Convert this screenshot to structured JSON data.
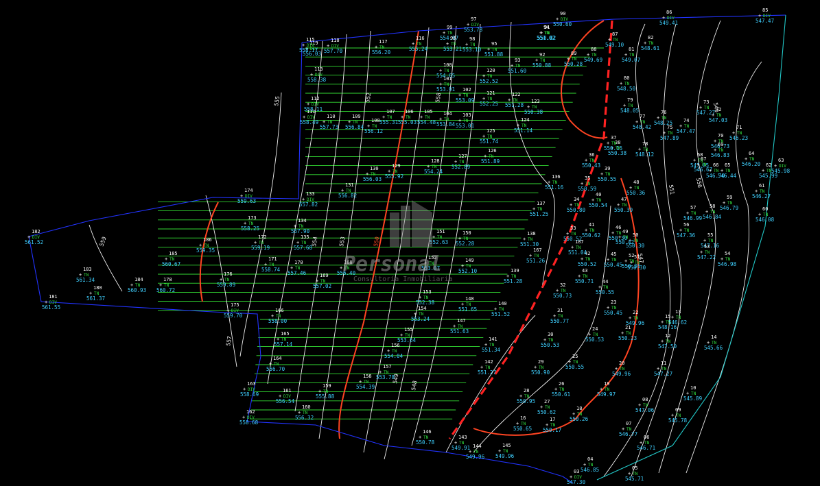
{
  "colors": {
    "background": "#000000",
    "boundary": "#2233ff",
    "boundary_right": "#22c8c8",
    "platform_lines": "#33dd33",
    "contour": "#f0f0f0",
    "contour_major": "#ff4422",
    "cut_line": "#ff2222",
    "point_number": "#ffffff",
    "elevation": "#3fd0ff",
    "code": "#30e040"
  },
  "watermark": {
    "brand": "Personal",
    "tagline": "Consultoría Inmobiliaria"
  },
  "contour_labels": [
    "559",
    "557",
    "555",
    "554",
    "553",
    "552",
    "550",
    "549",
    "548",
    "547",
    "551",
    "556",
    "558",
    "546"
  ],
  "points": [
    {
      "num": "182",
      "code": "DIV",
      "elev": "561.52"
    },
    {
      "num": "183",
      "code": "TN",
      "elev": "561.34"
    },
    {
      "num": "181",
      "code": "DIV",
      "elev": "561.55"
    },
    {
      "num": "180",
      "code": "TN",
      "elev": "561.37"
    },
    {
      "num": "184",
      "code": "TN",
      "elev": "560.93"
    },
    {
      "num": "174",
      "code": "DIV",
      "elev": "559.63"
    },
    {
      "num": "178",
      "code": "TN",
      "elev": "560.72"
    },
    {
      "num": "185",
      "code": "TN",
      "elev": "560.67"
    },
    {
      "num": "186",
      "code": "TN",
      "elev": "559.35"
    },
    {
      "num": "175",
      "code": "DIV",
      "elev": "559.70"
    },
    {
      "num": "176",
      "code": "TN",
      "elev": "559.89"
    },
    {
      "num": "173",
      "code": "TN",
      "elev": "558.25"
    },
    {
      "num": "172",
      "code": "TN",
      "elev": "559.19"
    },
    {
      "num": "171",
      "code": "TN",
      "elev": "558.74"
    },
    {
      "num": "133",
      "code": "DIV",
      "elev": "557.82"
    },
    {
      "num": "134",
      "code": "TN",
      "elev": "557.90"
    },
    {
      "num": "135",
      "code": "TN",
      "elev": "557.68"
    },
    {
      "num": "170",
      "code": "TN",
      "elev": "557.46"
    },
    {
      "num": "169",
      "code": "TN",
      "elev": "557.02"
    },
    {
      "num": "168",
      "code": "TN",
      "elev": "556.40"
    },
    {
      "num": "131",
      "code": "TN",
      "elev": "556.82"
    },
    {
      "num": "130",
      "code": "TN",
      "elev": "556.03"
    },
    {
      "num": "129",
      "code": "TN",
      "elev": "555.92"
    },
    {
      "num": "128",
      "code": "TN",
      "elev": "554.24"
    },
    {
      "num": "127",
      "code": "TN",
      "elev": "552.89"
    },
    {
      "num": "126",
      "code": "TN",
      "elev": "551.89"
    },
    {
      "num": "125",
      "code": "TN",
      "elev": "551.74"
    },
    {
      "num": "124",
      "code": "TN",
      "elev": "551.14"
    },
    {
      "num": "123",
      "code": "TN",
      "elev": "550.38"
    },
    {
      "num": "122",
      "code": "TN",
      "elev": "551.28"
    },
    {
      "num": "121",
      "code": "TN",
      "elev": "552.25"
    },
    {
      "num": "120",
      "code": "TN",
      "elev": "552.52"
    },
    {
      "num": "119",
      "code": "DIV",
      "elev": "556.03"
    },
    {
      "num": "118",
      "code": "DIV",
      "elev": "557.70"
    },
    {
      "num": "117",
      "code": "TN",
      "elev": "556.20"
    },
    {
      "num": "116",
      "code": "TN",
      "elev": "555.24"
    },
    {
      "num": "115",
      "code": "DIV",
      "elev": "558.17"
    },
    {
      "num": "113",
      "code": "DIV",
      "elev": "558.38"
    },
    {
      "num": "112",
      "code": "DIV",
      "elev": "558.11"
    },
    {
      "num": "111",
      "code": "DIV",
      "elev": "558.49"
    },
    {
      "num": "110",
      "code": "TN",
      "elev": "557.73"
    },
    {
      "num": "109",
      "code": "TN",
      "elev": "556.84"
    },
    {
      "num": "108",
      "code": "TN",
      "elev": "556.12"
    },
    {
      "num": "107",
      "code": "TN",
      "elev": "555.31"
    },
    {
      "num": "106",
      "code": "TN",
      "elev": "555.03"
    },
    {
      "num": "105",
      "code": "TN",
      "elev": "554.48"
    },
    {
      "num": "104",
      "code": "TN",
      "elev": "553.84"
    },
    {
      "num": "103",
      "code": "TN",
      "elev": "553.01"
    },
    {
      "num": "102",
      "code": "TN",
      "elev": "553.09"
    },
    {
      "num": "101",
      "code": "TN",
      "elev": "553.91"
    },
    {
      "num": "100",
      "code": "TN",
      "elev": "554.65"
    },
    {
      "num": "99",
      "code": "TN",
      "elev": "554.97"
    },
    {
      "num": "98",
      "code": "TN",
      "elev": "553.10"
    },
    {
      "num": "97",
      "code": "DIV",
      "elev": "553.78"
    },
    {
      "num": "96",
      "code": "TN",
      "elev": "553.21"
    },
    {
      "num": "95",
      "code": "TN",
      "elev": "551.88"
    },
    {
      "num": "94",
      "code": "TN",
      "elev": "551.02"
    },
    {
      "num": "93",
      "code": "TN",
      "elev": "551.60"
    },
    {
      "num": "92",
      "code": "TN",
      "elev": "550.88"
    },
    {
      "num": "91",
      "code": "TN",
      "elev": "550.02"
    },
    {
      "num": "90",
      "code": "DIV",
      "elev": "550.60"
    },
    {
      "num": "89",
      "code": "TN",
      "elev": "550.28"
    },
    {
      "num": "88",
      "code": "TN",
      "elev": "549.69"
    },
    {
      "num": "87",
      "code": "TN",
      "elev": "549.10"
    },
    {
      "num": "86",
      "code": "DIV",
      "elev": "549.41"
    },
    {
      "num": "85",
      "code": "DIV",
      "elev": "547.47"
    },
    {
      "num": "82",
      "code": "TN",
      "elev": "548.61"
    },
    {
      "num": "81",
      "code": "TN",
      "elev": "549.07"
    },
    {
      "num": "80",
      "code": "TN",
      "elev": "548.50"
    },
    {
      "num": "79",
      "code": "TN",
      "elev": "548.05"
    },
    {
      "num": "78",
      "code": "TN",
      "elev": "548.12"
    },
    {
      "num": "77",
      "code": "TN",
      "elev": "548.42"
    },
    {
      "num": "76",
      "code": "TN",
      "elev": "548.25"
    },
    {
      "num": "75",
      "code": "TN",
      "elev": "547.89"
    },
    {
      "num": "74",
      "code": "TN",
      "elev": "547.47"
    },
    {
      "num": "73",
      "code": "TN",
      "elev": "547.27"
    },
    {
      "num": "72",
      "code": "TN",
      "elev": "547.03"
    },
    {
      "num": "71",
      "code": "TN",
      "elev": "546.23"
    },
    {
      "num": "70",
      "code": "TN",
      "elev": "546.73"
    },
    {
      "num": "69",
      "code": "TN",
      "elev": "546.83"
    },
    {
      "num": "68",
      "code": "TN",
      "elev": "547.05"
    },
    {
      "num": "67",
      "code": "TN",
      "elev": "546.67"
    },
    {
      "num": "66",
      "code": "TN",
      "elev": "546.70"
    },
    {
      "num": "65",
      "code": "TN",
      "elev": "546.44"
    },
    {
      "num": "64",
      "code": "TN",
      "elev": "546.20"
    },
    {
      "num": "63",
      "code": "DIV",
      "elev": "545.98"
    },
    {
      "num": "62",
      "code": "TN",
      "elev": "545.99"
    },
    {
      "num": "61",
      "code": "TN",
      "elev": "546.27"
    },
    {
      "num": "60",
      "code": "TN",
      "elev": "546.08"
    },
    {
      "num": "59",
      "code": "TN",
      "elev": "546.79"
    },
    {
      "num": "58",
      "code": "TN",
      "elev": "546.84"
    },
    {
      "num": "57",
      "code": "TN",
      "elev": "546.99"
    },
    {
      "num": "56",
      "code": "TN",
      "elev": "547.36"
    },
    {
      "num": "55",
      "code": "TN",
      "elev": "547.16"
    },
    {
      "num": "54",
      "code": "TN",
      "elev": "546.98"
    },
    {
      "num": "53",
      "code": "TN",
      "elev": "547.22"
    },
    {
      "num": "52",
      "code": "TN",
      "elev": "550.36"
    },
    {
      "num": "51",
      "code": "TN",
      "elev": "550.30"
    },
    {
      "num": "50",
      "code": "TN",
      "elev": "550.30"
    },
    {
      "num": "49",
      "code": "TN",
      "elev": "550.42"
    },
    {
      "num": "48",
      "code": "TN",
      "elev": "550.36"
    },
    {
      "num": "47",
      "code": "TN",
      "elev": "550.39"
    },
    {
      "num": "46",
      "code": "TN",
      "elev": "550.30"
    },
    {
      "num": "45",
      "code": "TN",
      "elev": "550.45"
    },
    {
      "num": "44",
      "code": "TN",
      "elev": "550.55"
    },
    {
      "num": "43",
      "code": "TN",
      "elev": "550.71"
    },
    {
      "num": "42",
      "code": "TN",
      "elev": "550.52"
    },
    {
      "num": "41",
      "code": "TN",
      "elev": "550.62"
    },
    {
      "num": "40",
      "code": "TN",
      "elev": "550.54"
    },
    {
      "num": "39",
      "code": "TN",
      "elev": "550.55"
    },
    {
      "num": "38",
      "code": "TN",
      "elev": "550.38"
    },
    {
      "num": "37",
      "code": "TN",
      "elev": "550.15"
    },
    {
      "num": "36",
      "code": "TN",
      "elev": "550.43"
    },
    {
      "num": "35",
      "code": "TN",
      "elev": "550.59"
    },
    {
      "num": "34",
      "code": "TN",
      "elev": "550.80"
    },
    {
      "num": "33",
      "code": "TN",
      "elev": "550.52"
    },
    {
      "num": "32",
      "code": "TN",
      "elev": "550.73"
    },
    {
      "num": "31",
      "code": "TN",
      "elev": "550.77"
    },
    {
      "num": "30",
      "code": "TN",
      "elev": "550.53"
    },
    {
      "num": "29",
      "code": "TN",
      "elev": "550.90"
    },
    {
      "num": "28",
      "code": "TN",
      "elev": "550.95"
    },
    {
      "num": "27",
      "code": "TN",
      "elev": "550.62"
    },
    {
      "num": "26",
      "code": "TN",
      "elev": "550.61"
    },
    {
      "num": "25",
      "code": "TN",
      "elev": "550.55"
    },
    {
      "num": "24",
      "code": "TN",
      "elev": "550.53"
    },
    {
      "num": "23",
      "code": "TN",
      "elev": "550.45"
    },
    {
      "num": "22",
      "code": "TN",
      "elev": "549.96"
    },
    {
      "num": "21",
      "code": "TN",
      "elev": "550.23"
    },
    {
      "num": "20",
      "code": "TN",
      "elev": "549.96"
    },
    {
      "num": "19",
      "code": "TN",
      "elev": "549.97"
    },
    {
      "num": "18",
      "code": "TN",
      "elev": "550.26"
    },
    {
      "num": "17",
      "code": "TN",
      "elev": "550.17"
    },
    {
      "num": "16",
      "code": "TN",
      "elev": "550.65"
    },
    {
      "num": "15",
      "code": "TN",
      "elev": "548.16"
    },
    {
      "num": "14",
      "code": "TN",
      "elev": "545.66"
    },
    {
      "num": "13",
      "code": "TN",
      "elev": "546.62"
    },
    {
      "num": "12",
      "code": "TN",
      "elev": "547.50"
    },
    {
      "num": "11",
      "code": "TN",
      "elev": "547.27"
    },
    {
      "num": "10",
      "code": "TN",
      "elev": "545.89"
    },
    {
      "num": "09",
      "code": "TN",
      "elev": "545.78"
    },
    {
      "num": "08",
      "code": "TN",
      "elev": "547.06"
    },
    {
      "num": "07",
      "code": "TN",
      "elev": "546.77"
    },
    {
      "num": "06",
      "code": "TN",
      "elev": "546.71"
    },
    {
      "num": "05",
      "code": "TN",
      "elev": "545.71"
    },
    {
      "num": "04",
      "code": "TN",
      "elev": "546.85"
    },
    {
      "num": "03",
      "code": "DIV",
      "elev": "547.30"
    },
    {
      "num": "136",
      "code": "TN",
      "elev": "551.16"
    },
    {
      "num": "137",
      "code": "TN",
      "elev": "551.25"
    },
    {
      "num": "138",
      "code": "TN",
      "elev": "551.30"
    },
    {
      "num": "139",
      "code": "TN",
      "elev": "551.28"
    },
    {
      "num": "140",
      "code": "TN",
      "elev": "551.52"
    },
    {
      "num": "141",
      "code": "TN",
      "elev": "551.34"
    },
    {
      "num": "142",
      "code": "TN",
      "elev": "551.27"
    },
    {
      "num": "143",
      "code": "TN",
      "elev": "549.91"
    },
    {
      "num": "144",
      "code": "TN",
      "elev": "549.96"
    },
    {
      "num": "145",
      "code": "TN",
      "elev": "549.96"
    },
    {
      "num": "146",
      "code": "TN",
      "elev": "550.78"
    },
    {
      "num": "147",
      "code": "TN",
      "elev": "551.63"
    },
    {
      "num": "148",
      "code": "TN",
      "elev": "551.65"
    },
    {
      "num": "149",
      "code": "TN",
      "elev": "552.10"
    },
    {
      "num": "150",
      "code": "TN",
      "elev": "552.28"
    },
    {
      "num": "151",
      "code": "TN",
      "elev": "552.63"
    },
    {
      "num": "152",
      "code": "TN",
      "elev": "553.07"
    },
    {
      "num": "153",
      "code": "TN",
      "elev": "552.38"
    },
    {
      "num": "154",
      "code": "TN",
      "elev": "553.24"
    },
    {
      "num": "155",
      "code": "TN",
      "elev": "553.64"
    },
    {
      "num": "156",
      "code": "TN",
      "elev": "554.04"
    },
    {
      "num": "157",
      "code": "TN",
      "elev": "553.78"
    },
    {
      "num": "158",
      "code": "TN",
      "elev": "554.39"
    },
    {
      "num": "159",
      "code": "TN",
      "elev": "555.88"
    },
    {
      "num": "160",
      "code": "TN",
      "elev": "556.32"
    },
    {
      "num": "161",
      "code": "DIV",
      "elev": "556.54"
    },
    {
      "num": "162",
      "code": "DIV",
      "elev": "558.68"
    },
    {
      "num": "163",
      "code": "DIV",
      "elev": "558.69"
    },
    {
      "num": "164",
      "code": "TN",
      "elev": "556.70"
    },
    {
      "num": "165",
      "code": "TN",
      "elev": "557.14"
    },
    {
      "num": "166",
      "code": "TN",
      "elev": "558.00"
    },
    {
      "num": "167",
      "code": "TN",
      "elev": "551.26"
    },
    {
      "num": "187",
      "code": "TN",
      "elev": "551.04"
    }
  ]
}
